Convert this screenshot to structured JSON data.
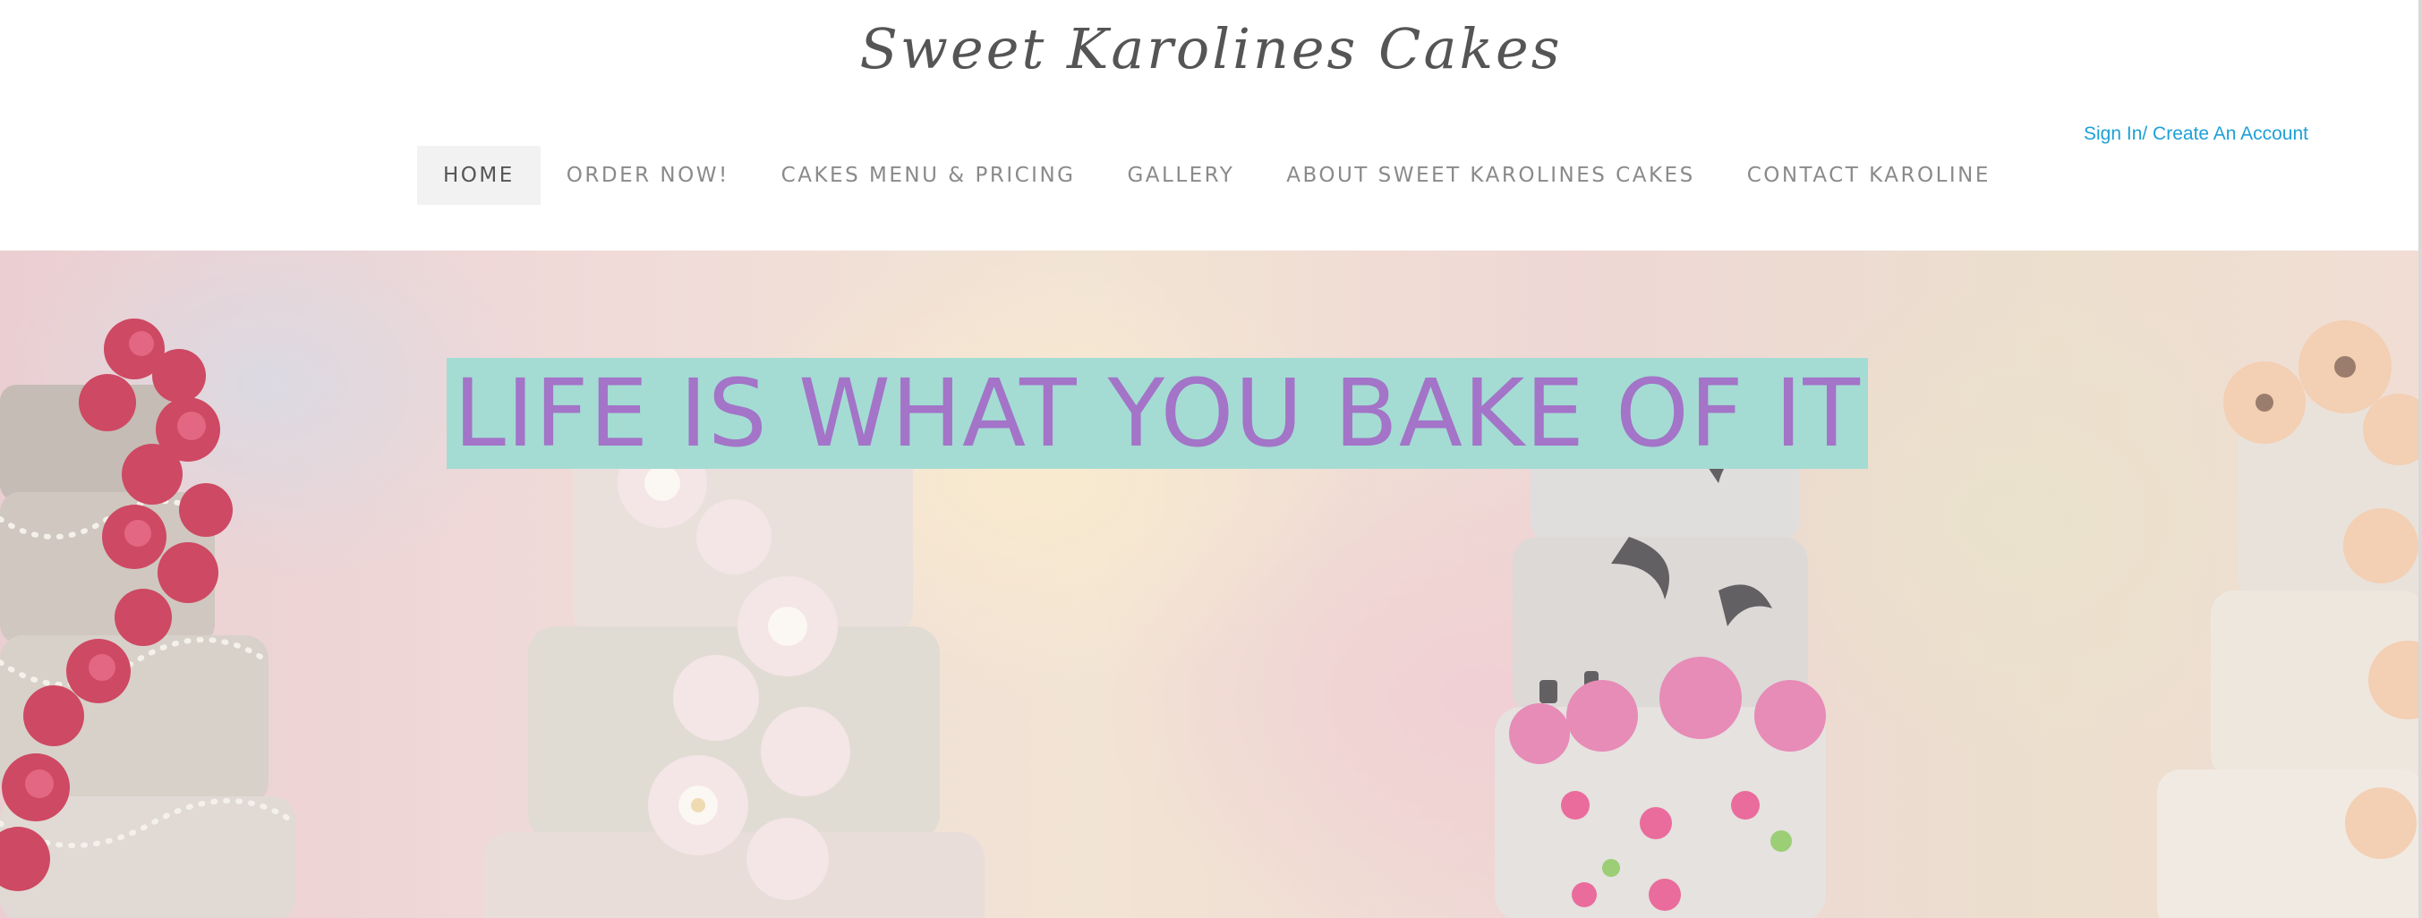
{
  "site": {
    "title": "Sweet Karolines Cakes"
  },
  "account": {
    "signin_label": "Sign In/ Create An Account"
  },
  "nav": {
    "items": [
      {
        "label": "HOME"
      },
      {
        "label": "ORDER NOW!"
      },
      {
        "label": "CAKES MENU & PRICING"
      },
      {
        "label": "GALLERY"
      },
      {
        "label": "ABOUT SWEET KAROLINES CAKES"
      },
      {
        "label": "CONTACT KAROLINE"
      }
    ],
    "active_index": 0
  },
  "hero": {
    "tagline": "\"LIFE IS WHAT YOU BAKE OF IT\"",
    "image_description_icon": "wedding-cakes-photo"
  },
  "colors": {
    "link": "#1ea0d6",
    "tagline_text": "#a374c8",
    "tagline_bg": "#a4dcd3",
    "nav_text": "#8a8a8a",
    "nav_active_bg": "#f2f2f2"
  }
}
